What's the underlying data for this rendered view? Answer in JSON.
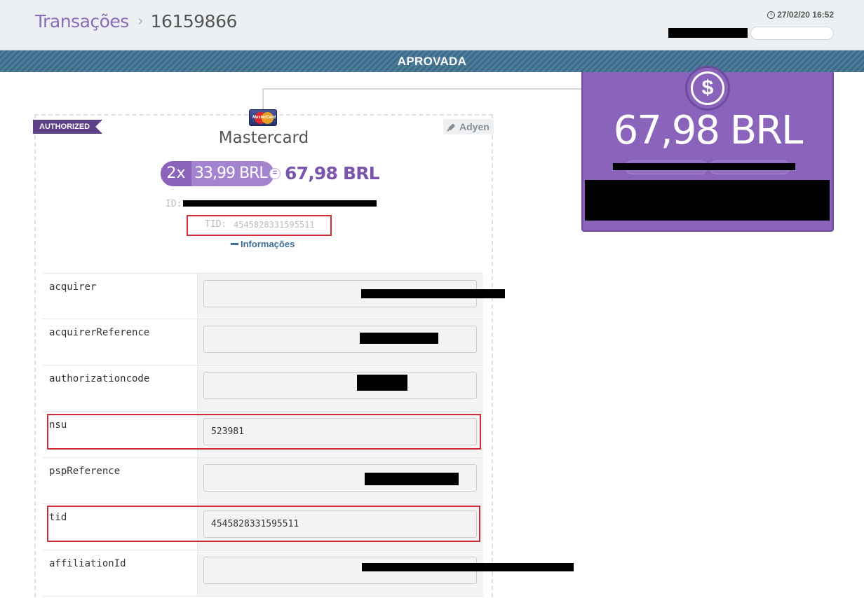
{
  "header": {
    "breadcrumb_link": "Transações",
    "breadcrumb_sep": "›",
    "transaction_id": "16159866",
    "timestamp": "27/02/20 16:52"
  },
  "status": {
    "label": "APROVADA"
  },
  "amount_card": {
    "icon": "dollar-icon",
    "icon_glyph": "$",
    "amount": "67,98 BRL",
    "color": "#8a63bb"
  },
  "transaction": {
    "status_badge": "AUTHORIZED",
    "gateway": "Adyen",
    "card_brand": "Mastercard",
    "card_icon_text": "MasterCard",
    "installments": "2x",
    "installment_value": "33,99 BRL",
    "equals_glyph": "=",
    "total": "67,98 BRL",
    "id_label": "ID:",
    "tid_label": "TID:",
    "tid_value": "4545828331595511",
    "info_toggle_label": "Informações"
  },
  "info": {
    "rows": [
      {
        "key": "acquirer",
        "value": ""
      },
      {
        "key": "acquirerReference",
        "value": ""
      },
      {
        "key": "authorizationcode",
        "value": ""
      },
      {
        "key": "nsu",
        "value": "523981"
      },
      {
        "key": "pspReference",
        "value": ""
      },
      {
        "key": "tid",
        "value": "4545828331595511"
      },
      {
        "key": "affiliationId",
        "value": ""
      }
    ]
  },
  "colors": {
    "accent_purple": "#8a63bb",
    "status_bar": "#3e6b88",
    "highlight_red": "#cc2e34"
  }
}
